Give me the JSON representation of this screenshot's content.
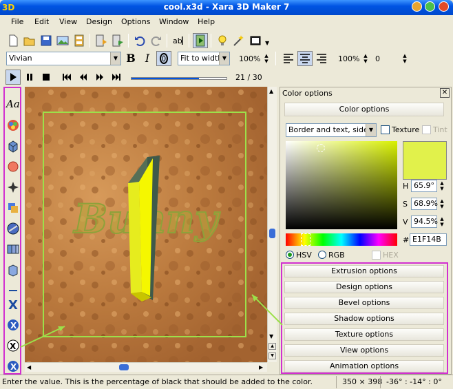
{
  "window": {
    "title": "cool.x3d - Xara 3D Maker 7",
    "logo": "3D"
  },
  "menu": [
    "File",
    "Edit",
    "View",
    "Design",
    "Options",
    "Window",
    "Help"
  ],
  "text_toolbar": {
    "font": "Vivian",
    "bold": "B",
    "italic": "I",
    "fit": "Fit to width",
    "zoom1": "100%",
    "zoom2": "100%",
    "spacing": "0"
  },
  "playback": {
    "frame": "21 / 30",
    "progress": 0.7
  },
  "scene": {
    "text": "Bunny"
  },
  "color_options": {
    "panel_title": "Color options",
    "section_title": "Color options",
    "target": "Border and text, sides",
    "texture_label": "Texture",
    "tint_label": "Tint",
    "h_label": "H",
    "h_value": "65.9°",
    "s_label": "S",
    "s_value": "68.9%",
    "v_label": "V",
    "v_value": "94.5%",
    "hex_prefix": "#",
    "hex_value": "E1F14B",
    "hsv_label": "HSV",
    "rgb_label": "RGB",
    "hex_label": "HEX",
    "swatch_color": "#e1f14b"
  },
  "sections": [
    "Extrusion options",
    "Design options",
    "Bevel options",
    "Shadow options",
    "Texture options",
    "View options",
    "Animation options"
  ],
  "status": {
    "message": "Enter the value. This is the percentage of black that should be added to the color.",
    "size": "350 × 398",
    "angles": "-36° : -14° : 0°"
  },
  "colors": {
    "highlight": "#d22fd0",
    "arrow": "#9ce04a",
    "accent": "#0054e3"
  }
}
